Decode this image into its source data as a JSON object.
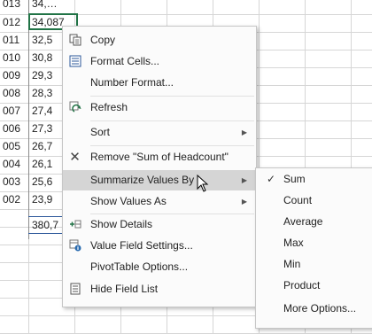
{
  "sheet": {
    "rows": [
      {
        "a": "013",
        "b": "34,…"
      },
      {
        "a": "012",
        "b": "34,087"
      },
      {
        "a": "011",
        "b": "32,5"
      },
      {
        "a": "010",
        "b": "30,8"
      },
      {
        "a": "009",
        "b": "29,3"
      },
      {
        "a": "008",
        "b": "28,3"
      },
      {
        "a": "007",
        "b": "27,4"
      },
      {
        "a": "006",
        "b": "27,3"
      },
      {
        "a": "005",
        "b": "26,7"
      },
      {
        "a": "004",
        "b": "26,1"
      },
      {
        "a": "003",
        "b": "25,6"
      },
      {
        "a": "002",
        "b": "23,9"
      },
      {
        "a": "",
        "b": "380,7"
      }
    ]
  },
  "context_menu": {
    "items": [
      {
        "label": "Copy",
        "icon": "copy-icon"
      },
      {
        "label": "Format Cells...",
        "icon": "format-cells-icon"
      },
      {
        "label": "Number Format...",
        "icon": ""
      },
      {
        "label": "Refresh",
        "icon": "refresh-icon"
      },
      {
        "label": "Sort",
        "icon": "",
        "submenu": true
      },
      {
        "label": "Remove \"Sum of Headcount\"",
        "icon": "remove-icon"
      },
      {
        "label": "Summarize Values By",
        "icon": "",
        "submenu": true,
        "highlighted": true
      },
      {
        "label": "Show Values As",
        "icon": "",
        "submenu": true
      },
      {
        "label": "Show Details",
        "icon": "show-details-icon"
      },
      {
        "label": "Value Field Settings...",
        "icon": "value-field-settings-icon"
      },
      {
        "label": "PivotTable Options...",
        "icon": ""
      },
      {
        "label": "Hide Field List",
        "icon": "field-list-icon"
      }
    ]
  },
  "summarize_submenu": {
    "items": [
      {
        "label": "Sum",
        "checked": true
      },
      {
        "label": "Count",
        "checked": false
      },
      {
        "label": "Average",
        "checked": false
      },
      {
        "label": "Max",
        "checked": false
      },
      {
        "label": "Min",
        "checked": false
      },
      {
        "label": "Product",
        "checked": false
      },
      {
        "label": "More Options...",
        "checked": false
      }
    ]
  },
  "glyphs": {
    "check": "✓",
    "arrow": "▶",
    "remove": "✕"
  }
}
